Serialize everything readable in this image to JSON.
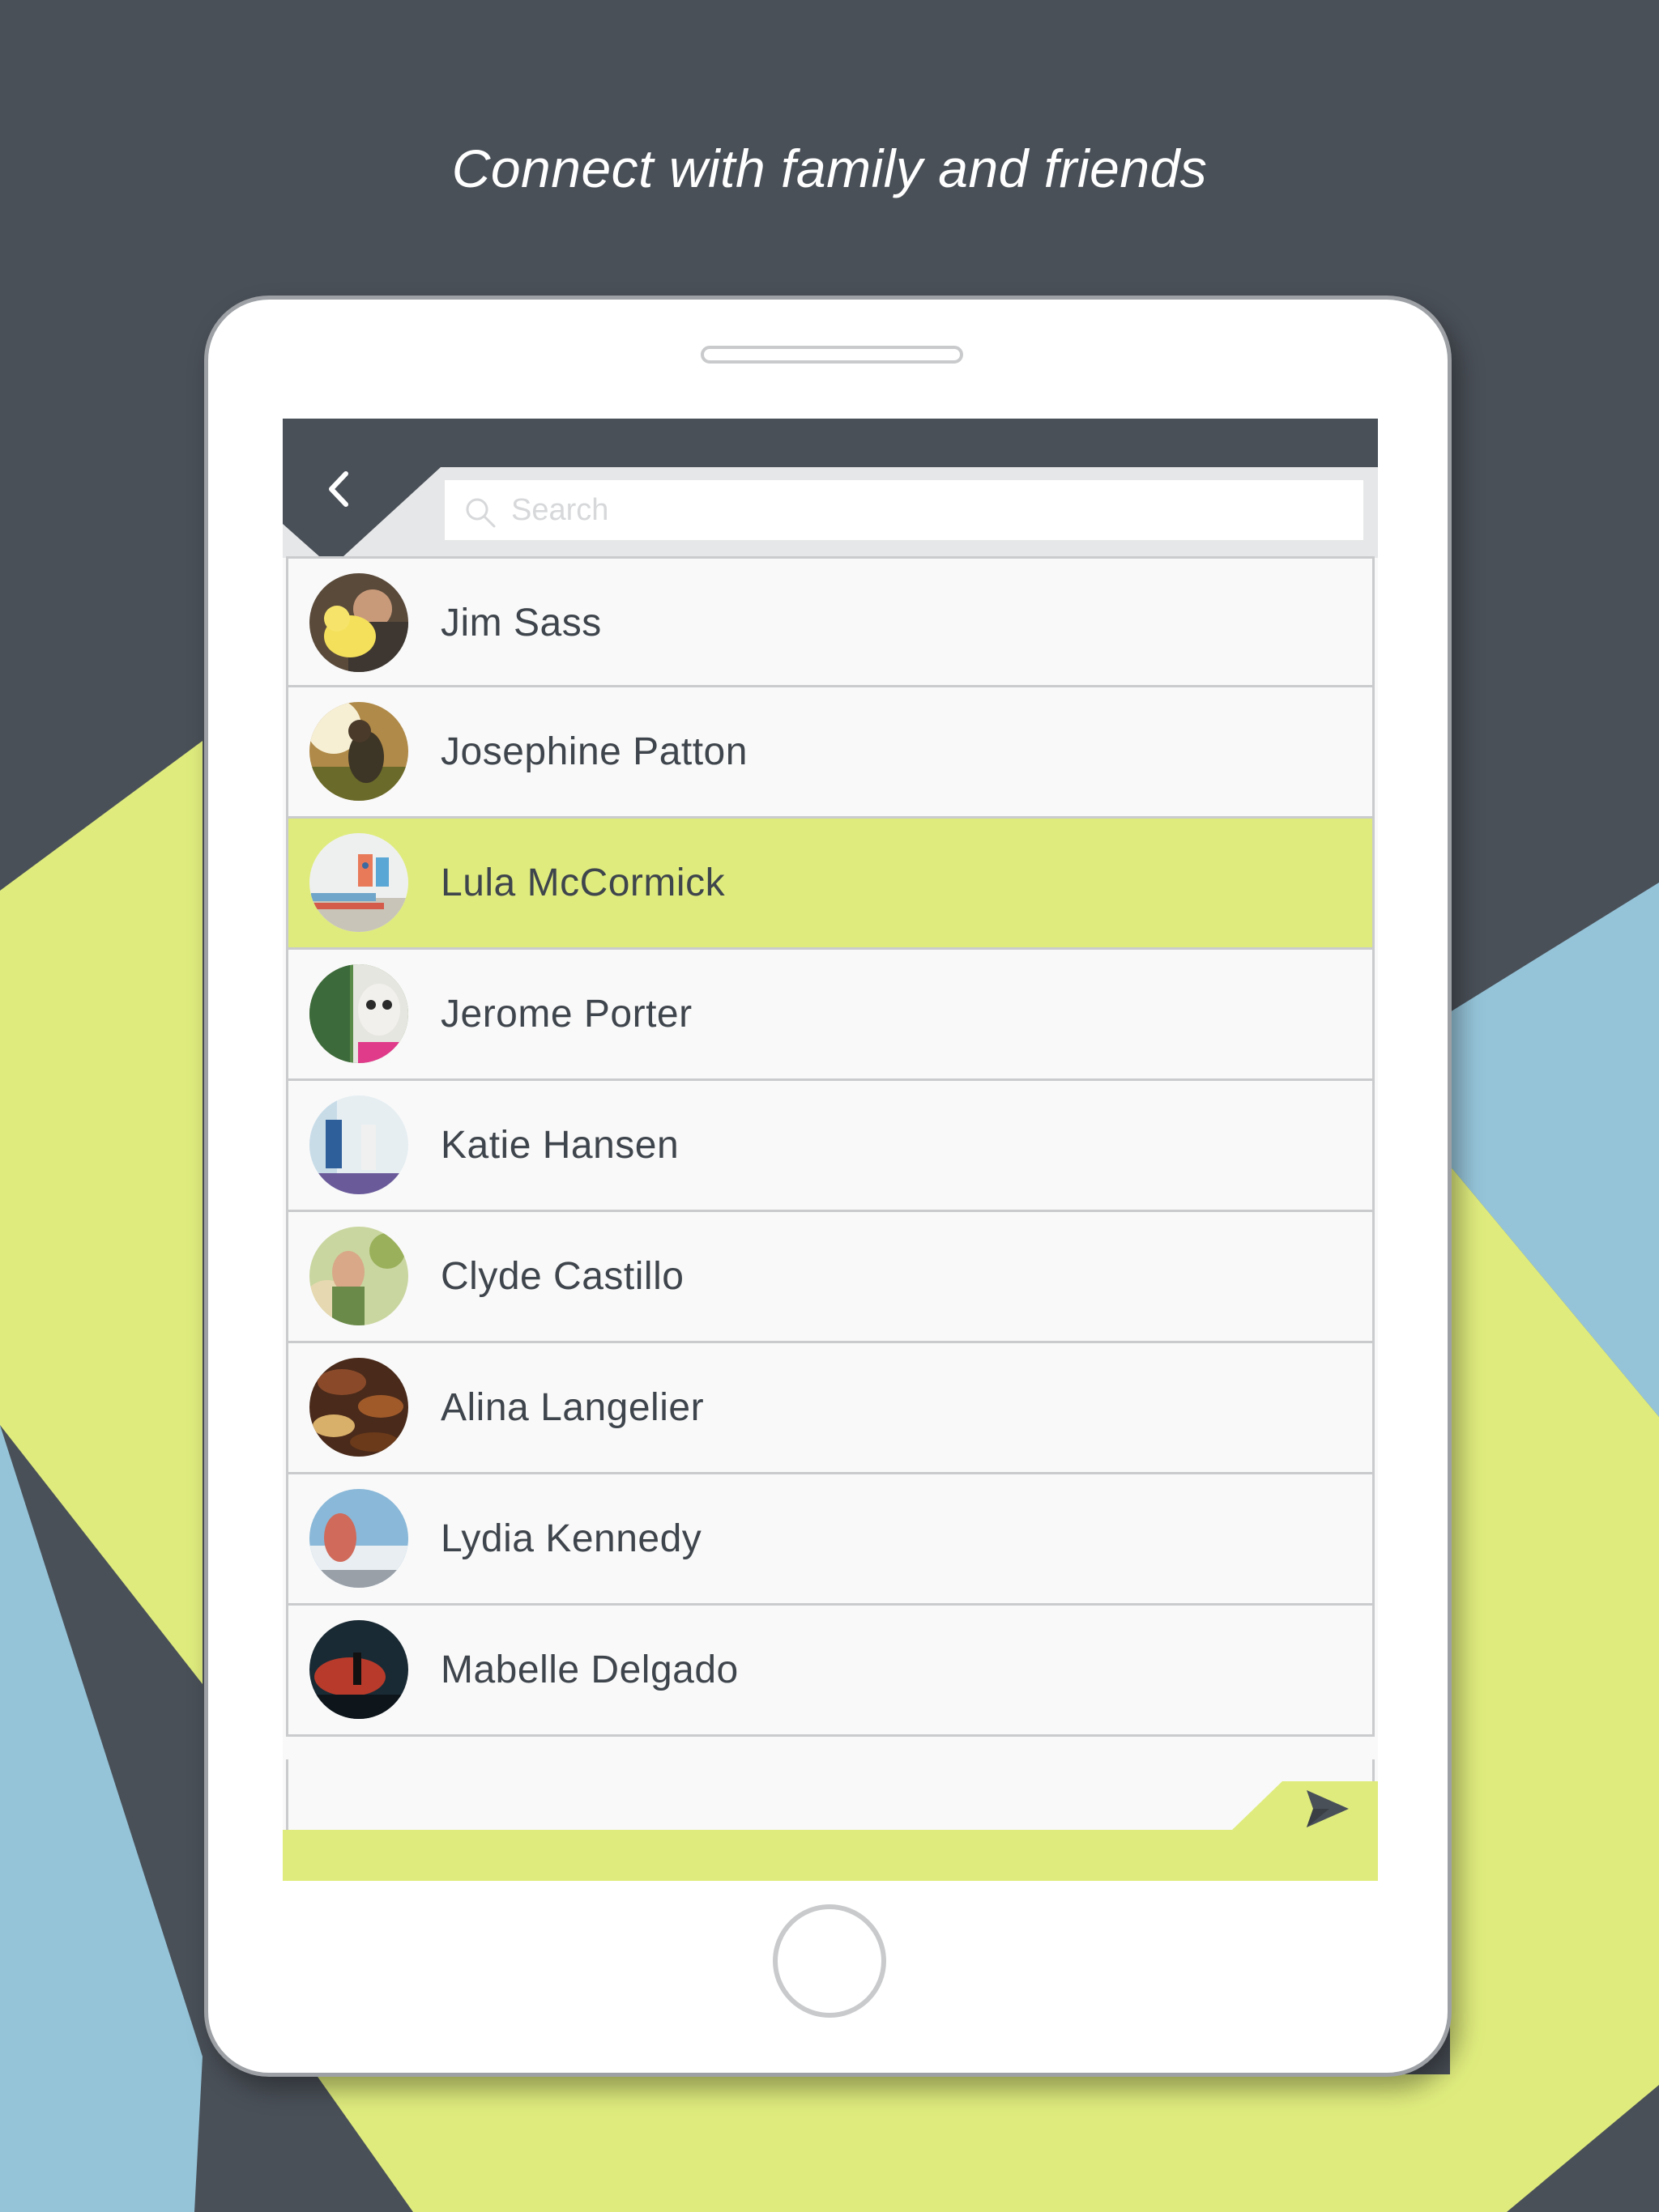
{
  "colors": {
    "background_dark": "#4a5058",
    "accent_lime": "#dfec7d",
    "accent_blue": "#95c4d9",
    "row_background": "#f9f9f9",
    "text": "#3f454c"
  },
  "headline": "Connect with family and friends",
  "search": {
    "icon": "search-icon",
    "placeholder": "Search"
  },
  "navigation": {
    "back_icon": "chevron-left-icon",
    "send_icon": "paper-plane-icon"
  },
  "contacts": [
    {
      "name": "Jim Sass",
      "selected": false
    },
    {
      "name": "Josephine Patton",
      "selected": false
    },
    {
      "name": "Lula McCormick",
      "selected": true
    },
    {
      "name": "Jerome Porter",
      "selected": false
    },
    {
      "name": "Katie Hansen",
      "selected": false
    },
    {
      "name": "Clyde Castillo",
      "selected": false
    },
    {
      "name": "Alina Langelier",
      "selected": false
    },
    {
      "name": "Lydia Kennedy",
      "selected": false
    },
    {
      "name": "Mabelle Delgado",
      "selected": false
    }
  ]
}
